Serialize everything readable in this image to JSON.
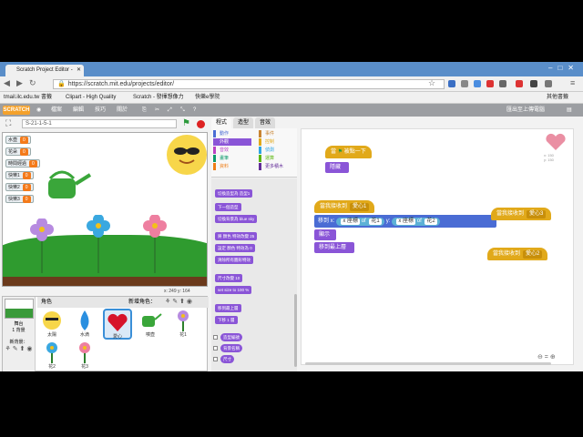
{
  "browser": {
    "tab_title": "Scratch Project Editor - ",
    "url": "https://scratch.mit.edu/projects/editor/",
    "bookmarks": [
      "tmail.ilc.edu.tw 書籤",
      "Clipart - High Quality",
      "Scratch - 發揮想像力",
      "快樂e學院",
      "其他書籤"
    ]
  },
  "scratch": {
    "logo": "SCRATCH",
    "menu": [
      "檔案",
      "編輯",
      "技巧",
      "關於"
    ],
    "user": "匯出至上傳電腦",
    "project_name": "S-21-1-5-1",
    "stage_monitors": [
      {
        "label": "水壺",
        "value": "0"
      },
      {
        "label": "花朵",
        "value": "0"
      },
      {
        "label": "時間經過",
        "value": "0"
      },
      {
        "label": "快樂1",
        "value": "0"
      },
      {
        "label": "快樂2",
        "value": "0"
      },
      {
        "label": "快樂3",
        "value": "0"
      }
    ],
    "coords": "x: 249  y: 164",
    "sprites_header": "角色",
    "new_sprite_label": "新增角色：",
    "stage_label": "舞台",
    "stage_sub": "1 背景",
    "new_backdrop": "新背景：",
    "sprites": [
      "太陽",
      "水滴",
      "愛心",
      "噴壺",
      "花1",
      "花2",
      "花3"
    ],
    "tabs": [
      "程式",
      "造型",
      "音效"
    ],
    "categories_left": [
      "動作",
      "外觀",
      "音效",
      "畫筆",
      "資料"
    ],
    "categories_right": [
      "事件",
      "控制",
      "偵測",
      "運算",
      "更多積木"
    ],
    "palette_blocks": [
      "切換造型為 造型1",
      "下一個造型",
      "切換背景為 blue sky",
      "將 顏色 特效改變 25",
      "設定 顏色 特效為 0",
      "清除所有圖形特效",
      "尺寸改變 10",
      "set size to 100 %",
      "移到最上層",
      "下移 1 層",
      "造型編號",
      "背景名稱",
      "尺寸"
    ],
    "scripts": {
      "when_flag": "當",
      "when_flag_tail": "被點一下",
      "hide": "隱藏",
      "receive1": "當我接收到",
      "receive1_msg": "愛心1",
      "goto": "移到 x:",
      "x_of": "x 座標",
      "of1": "of",
      "target1": "花1",
      "y": "y:",
      "x_of2": "x 座標",
      "of2": "of",
      "target2": "花2",
      "show": "顯示",
      "front": "移到最上層",
      "receive2": "當我接收到",
      "receive2_msg": "愛心2",
      "receive3": "當我接收到",
      "receive3_msg": "愛心3",
      "sprite_xy": "x: 150\ny: 150"
    }
  }
}
